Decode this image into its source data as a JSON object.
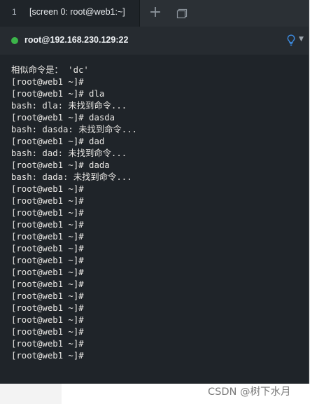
{
  "tab": {
    "index": "1",
    "title": "[screen 0: root@web1:~]",
    "add_icon": "plus-icon",
    "window_icon": "window-icon"
  },
  "host": {
    "status_color": "#3cb54a",
    "label": "root@192.168.230.129:22",
    "bulb_icon": "lightbulb-icon",
    "bulb_color": "#3d8ee6"
  },
  "terminal": {
    "lines": [
      "相似命令是： 'dc'",
      "[root@web1 ~]#",
      "[root@web1 ~]# dla",
      "bash: dla: 未找到命令...",
      "[root@web1 ~]# dasda",
      "bash: dasda: 未找到命令...",
      "[root@web1 ~]# dad",
      "bash: dad: 未找到命令...",
      "[root@web1 ~]# dada",
      "bash: dada: 未找到命令...",
      "[root@web1 ~]#",
      "[root@web1 ~]#",
      "[root@web1 ~]#",
      "[root@web1 ~]#",
      "[root@web1 ~]#",
      "[root@web1 ~]#",
      "[root@web1 ~]#",
      "[root@web1 ~]#",
      "[root@web1 ~]#",
      "[root@web1 ~]#",
      "[root@web1 ~]#",
      "[root@web1 ~]#",
      "[root@web1 ~]#",
      "[root@web1 ~]#",
      "[root@web1 ~]#"
    ]
  },
  "watermark": "CSDN @树下水月"
}
